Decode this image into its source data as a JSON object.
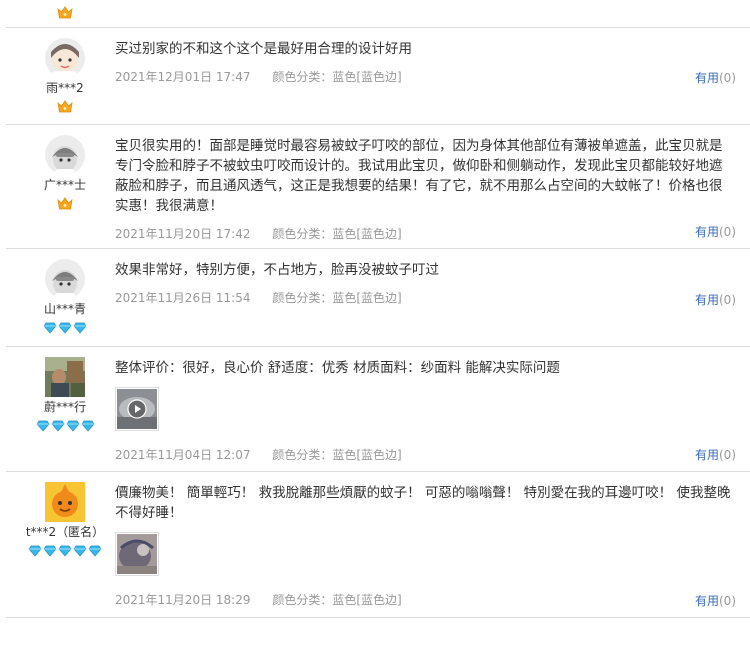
{
  "reviews": [
    {
      "username": "雨***2",
      "text": "买过别家的不和这个这个是最好用合理的设计好用",
      "date": "2021年12月01日 17:47",
      "spec": "颜色分类：蓝色[蓝色边]",
      "useful_label": "有用",
      "useful_count": "(0)"
    },
    {
      "username": "广***士",
      "text": "宝贝很实用的！面部是睡觉时最容易被蚊子叮咬的部位，因为身体其他部位有薄被单遮盖，此宝贝就是专门令脸和脖子不被蚊虫叮咬而设计的。我试用此宝贝，做仰卧和侧躺动作，发现此宝贝都能较好地遮蔽脸和脖子，而且通风透气，这正是我想要的结果！有了它，就不用那么占空间的大蚊帐了！价格也很实惠！我很满意！",
      "date": "2021年11月20日 17:42",
      "spec": "颜色分类：蓝色[蓝色边]",
      "useful_label": "有用",
      "useful_count": "(0)"
    },
    {
      "username": "山***青",
      "text": "效果非常好，特别方便，不占地方，脸再没被蚊子叮过",
      "date": "2021年11月26日 11:54",
      "spec": "颜色分类：蓝色[蓝色边]",
      "useful_label": "有用",
      "useful_count": "(0)"
    },
    {
      "username": "蔚***行",
      "text": "整体评价：很好，良心价 舒适度：优秀 材质面料：纱面料 能解决实际问题",
      "date": "2021年11月04日 12:07",
      "spec": "颜色分类：蓝色[蓝色边]",
      "useful_label": "有用",
      "useful_count": "(0)"
    },
    {
      "username": "t***2（匿名）",
      "text": "價廉物美！ 簡單輕巧！ 救我脫離那些煩厭的蚊子！ 可惡的嗡嗡聲！ 特別愛在我的耳邊叮咬！ 使我整晚不得好睡！",
      "date": "2021年11月20日 18:29",
      "spec": "颜色分类：蓝色[蓝色边]",
      "useful_label": "有用",
      "useful_count": "(0)"
    }
  ],
  "icons": {
    "crown": "crown-icon",
    "diamond": "diamond-icon",
    "play": "play-icon"
  },
  "colors": {
    "link": "#3a6cb4",
    "meta": "#999999",
    "crown": "#f5a623",
    "diamond": "#3ab7ea"
  }
}
